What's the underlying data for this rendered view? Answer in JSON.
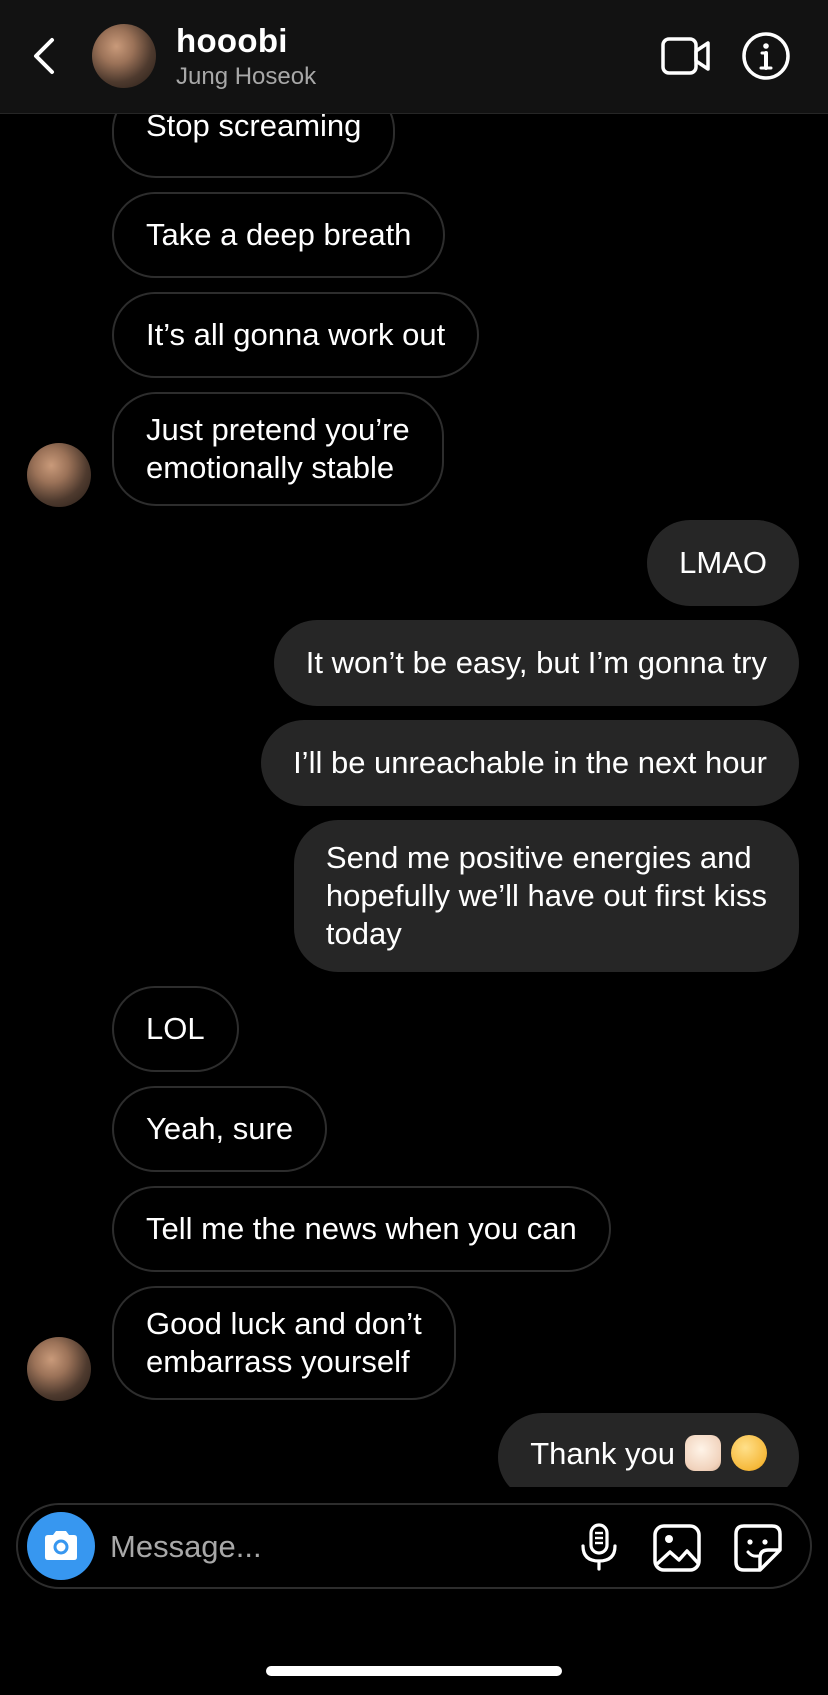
{
  "header": {
    "username": "hooobi",
    "full_name": "Jung Hoseok"
  },
  "messages": [
    {
      "from": "them",
      "text": "Stop screaming"
    },
    {
      "from": "them",
      "text": "Take a deep breath"
    },
    {
      "from": "them",
      "text": "It’s all gonna work out"
    },
    {
      "from": "them",
      "lines": [
        "Just pretend you’re",
        "emotionally stable"
      ]
    },
    {
      "from": "me",
      "text": "LMAO"
    },
    {
      "from": "me",
      "text": "It won’t be easy, but I’m gonna try"
    },
    {
      "from": "me",
      "text": "I’ll be unreachable in the next hour"
    },
    {
      "from": "me",
      "lines": [
        "Send me positive energies and",
        "hopefully we’ll have out first kiss",
        "today"
      ]
    },
    {
      "from": "them",
      "text": "LOL"
    },
    {
      "from": "them",
      "text": "Yeah, sure"
    },
    {
      "from": "them",
      "text": "Tell me the news when you can"
    },
    {
      "from": "them",
      "lines": [
        "Good luck and don’t",
        "embarrass yourself"
      ]
    },
    {
      "from": "me",
      "text": "Thank you",
      "emojis": [
        "raised-fist-emoji",
        "sneezing-face-emoji"
      ]
    }
  ],
  "composer": {
    "placeholder": "Message..."
  },
  "icons": {
    "back": "chevron-left-icon",
    "video": "video-camera-icon",
    "info": "info-icon",
    "camera": "camera-icon",
    "mic": "microphone-icon",
    "gallery": "gallery-icon",
    "sticker": "sticker-icon"
  },
  "colors": {
    "background": "#000000",
    "header": "#121212",
    "outgoing_bubble": "#262626",
    "incoming_border": "#2d2d2d",
    "camera_button": "#3797f0",
    "secondary_text": "#a8a8a8"
  }
}
